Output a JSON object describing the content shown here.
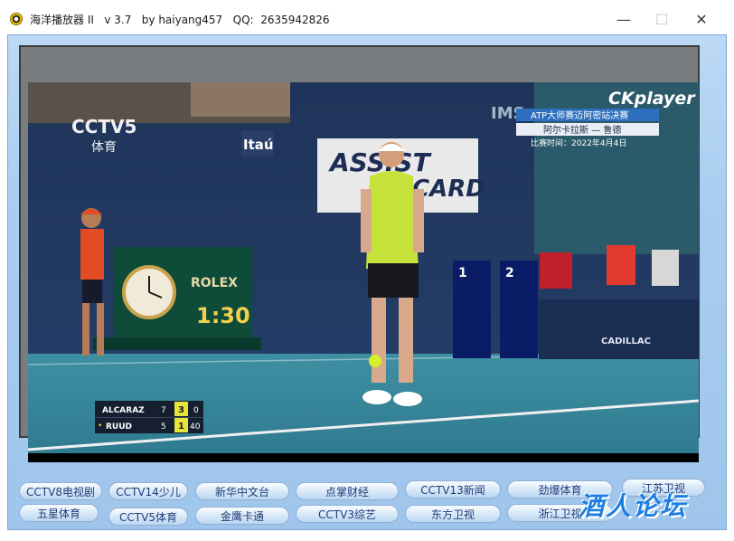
{
  "window": {
    "title": "海洋播放器 II   v 3.7   by haiyang457   QQ:  2635942826",
    "minimize_glyph": "—",
    "maximize_glyph": "☐",
    "close_glyph": "✕"
  },
  "player": {
    "brand": "CKplayer",
    "channel_logo": "CCTV5",
    "channel_sub": "体育",
    "match_title": "ATP大师赛迈阿密站决赛",
    "match_players": "阿尔卡拉斯 — 鲁德",
    "match_date": "比赛时间：2022年4月4日",
    "sponsor_itau": "Itaú",
    "sponsor_assist_a": "ASSIST",
    "sponsor_assist_b": "CARD",
    "rolex": "ROLEX",
    "clock": "1:30",
    "cadillac": "CADILLAC",
    "court_marker_1": "1",
    "court_marker_2": "2",
    "ims": "IMS",
    "scoreboard": [
      {
        "name": "ALCARAZ",
        "sets": "7",
        "games": "3",
        "points": "0",
        "serving": ""
      },
      {
        "name": "RUUD",
        "sets": "5",
        "games": "1",
        "points": "40",
        "serving": "•"
      }
    ]
  },
  "channels": {
    "row1": [
      "CCTV8电视剧",
      "CCTV14少儿",
      "新华中文台",
      "点掌财经",
      "CCTV13新闻",
      "劲爆体育",
      "江苏卫视"
    ],
    "row2": [
      "五星体育",
      "CCTV5体育",
      "金鹰卡通",
      "CCTV3综艺",
      "东方卫视",
      "浙江卫视"
    ]
  },
  "watermark": "酒人论坛"
}
